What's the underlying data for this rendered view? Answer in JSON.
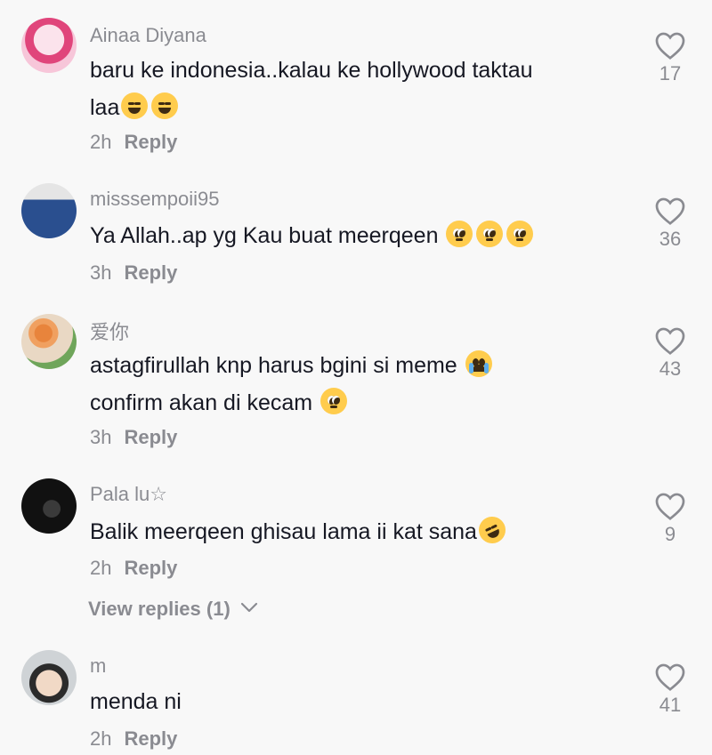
{
  "comments": [
    {
      "username": "Ainaa Diyana",
      "line1": "baru ke indonesia..kalau ke hollywood taktau",
      "line2": "laa",
      "time": "2h",
      "reply": "Reply",
      "likes": "17",
      "avatar_colors": [
        "#f7c6d9",
        "#e0457b"
      ]
    },
    {
      "username": "misssempoii95",
      "line1": "Ya Allah..ap yg Kau buat meerqeen",
      "time": "3h",
      "reply": "Reply",
      "likes": "36",
      "avatar_colors": [
        "#d8d8d8",
        "#2a4f8f"
      ]
    },
    {
      "username": "爱你",
      "line1": "astagfirullah knp harus bgini si meme",
      "line2": "confirm akan di kecam",
      "time": "3h",
      "reply": "Reply",
      "likes": "43",
      "avatar_colors": [
        "#e9d8c4",
        "#e8843c"
      ]
    },
    {
      "username": "Pala lu☆",
      "line1": "Balik meerqeen ghisau lama ii kat sana",
      "time": "2h",
      "reply": "Reply",
      "likes": "9",
      "avatar_colors": [
        "#1a1a1a",
        "#3a3a3a"
      ]
    },
    {
      "username": "m",
      "line1": "menda ni",
      "time": "2h",
      "reply": "Reply",
      "likes": "41",
      "avatar_colors": [
        "#cfd3d6",
        "#2b2b2b"
      ]
    }
  ],
  "view_replies": "View replies (1)",
  "icons": {
    "like": "heart-outline-icon",
    "expand": "chevron-down-icon"
  }
}
